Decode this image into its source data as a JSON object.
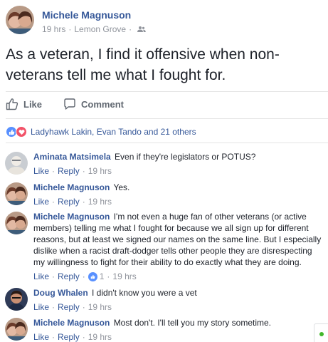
{
  "post": {
    "author": "Michele Magnuson",
    "time": "19 hrs",
    "location": "Lemon Grove",
    "separator": "·",
    "privacy_icon": "friends-icon",
    "text": "As a veteran, I find it offensive when non-veterans tell me what I fought for."
  },
  "actions": {
    "like_label": "Like",
    "comment_label": "Comment"
  },
  "reactions": {
    "icons": [
      "like-icon",
      "love-icon"
    ],
    "summary": "Ladyhawk Lakin, Evan Tando and 21 others"
  },
  "comments": [
    {
      "author": "Aminata Matsimela",
      "text": "Even if they're legislators or POTUS?",
      "like_label": "Like",
      "reply_label": "Reply",
      "time": "19 hrs"
    },
    {
      "author": "Michele Magnuson",
      "text": "Yes.",
      "like_label": "Like",
      "reply_label": "Reply",
      "time": "19 hrs"
    },
    {
      "author": "Michele Magnuson",
      "text": "I'm not even a huge fan of other veterans (or active members) telling me what I fought for because we all sign up for different reasons, but at least we signed our names on the same line. But I especially dislike when a racist draft-dodger tells other people they are disrespecting my willingness to fight for their ability to do exactly what they are doing.",
      "like_label": "Like",
      "reply_label": "Reply",
      "like_count": "1",
      "time": "19 hrs"
    },
    {
      "author": "Doug Whalen",
      "text": "I didn't know you were a vet",
      "like_label": "Like",
      "reply_label": "Reply",
      "time": "19 hrs"
    },
    {
      "author": "Michele Magnuson",
      "text": "Most don't. I'll tell you my story sometime.",
      "like_label": "Like",
      "reply_label": "Reply",
      "time": "19 hrs"
    }
  ],
  "colors": {
    "link_blue": "#365899",
    "meta_gray": "#90949c",
    "like_blue": "#5890ff",
    "love_red": "#f25268",
    "online_green": "#42b72a"
  }
}
